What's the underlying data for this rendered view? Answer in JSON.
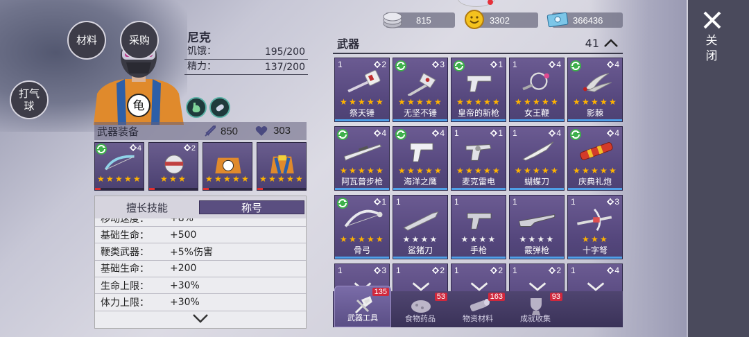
{
  "left_buttons": {
    "materials": "材料",
    "purchase": "采购",
    "orb": "打气球"
  },
  "character": {
    "name": "尼克",
    "hunger_label": "饥饿：",
    "hunger_value": "195/200",
    "energy_label": "精力：",
    "energy_value": "137/200",
    "chest_emblem": "龟"
  },
  "equipment": {
    "title": "武器装备",
    "attack": "850",
    "health": "303",
    "slots": [
      {
        "count": "4",
        "stars": 5,
        "recycle": true
      },
      {
        "count": "2",
        "stars": 3,
        "recycle": false
      },
      {
        "count": "",
        "stars": 5,
        "recycle": false
      },
      {
        "count": "",
        "stars": 5,
        "recycle": false
      }
    ]
  },
  "skills_panel": {
    "tab_skills": "擅长技能",
    "tab_titles": "称号",
    "rows": [
      {
        "label": "移动速度：",
        "value": "+8%"
      },
      {
        "label": "基础生命：",
        "value": "+500"
      },
      {
        "label": "鞭类武器：",
        "value": "+5%伤害"
      },
      {
        "label": "基础生命：",
        "value": "+200"
      },
      {
        "label": "生命上限：",
        "value": "+30%"
      },
      {
        "label": "体力上限：",
        "value": "+30%"
      }
    ]
  },
  "currency": {
    "silver": "815",
    "gold": "3302",
    "cash": "366436"
  },
  "inventory": {
    "category": "武器",
    "count": "41",
    "items": [
      {
        "name": "祭天锤",
        "lv": "1",
        "count": "2",
        "stars": 5,
        "recycle": false,
        "icon": "hammer"
      },
      {
        "name": "无坚不锤",
        "lv": "",
        "count": "3",
        "stars": 5,
        "recycle": true,
        "icon": "warhammer"
      },
      {
        "name": "皇帝的新枪",
        "lv": "",
        "count": "1",
        "stars": 5,
        "recycle": true,
        "icon": "pistol"
      },
      {
        "name": "女王鞭",
        "lv": "1",
        "count": "4",
        "stars": 5,
        "recycle": false,
        "icon": "whip"
      },
      {
        "name": "影棘",
        "lv": "",
        "count": "4",
        "stars": 5,
        "recycle": true,
        "icon": "claws"
      },
      {
        "name": "阿瓦普步枪",
        "lv": "",
        "count": "4",
        "stars": 5,
        "recycle": true,
        "icon": "rifle"
      },
      {
        "name": "海洋之鹰",
        "lv": "",
        "count": "4",
        "stars": 5,
        "recycle": true,
        "icon": "deagle"
      },
      {
        "name": "麦克雷电",
        "lv": "1",
        "count": "1",
        "stars": 5,
        "recycle": false,
        "icon": "revolver"
      },
      {
        "name": "蝴蝶刀",
        "lv": "1",
        "count": "4",
        "stars": 5,
        "recycle": false,
        "icon": "knife"
      },
      {
        "name": "庆典礼炮",
        "lv": "",
        "count": "4",
        "stars": 5,
        "recycle": true,
        "icon": "cannon"
      },
      {
        "name": "骨弓",
        "lv": "",
        "count": "1",
        "stars": 5,
        "recycle": true,
        "icon": "bow"
      },
      {
        "name": "鲨猪刀",
        "lv": "1",
        "count": "",
        "stars": 4,
        "stars_white": true,
        "recycle": false,
        "icon": "drill"
      },
      {
        "name": "手枪",
        "lv": "1",
        "count": "",
        "stars": 4,
        "stars_white": true,
        "recycle": false,
        "icon": "handgun"
      },
      {
        "name": "霰弹枪",
        "lv": "1",
        "count": "",
        "stars": 4,
        "stars_white": true,
        "recycle": false,
        "icon": "shotgun"
      },
      {
        "name": "十字弩",
        "lv": "1",
        "count": "3",
        "stars": 3,
        "recycle": false,
        "icon": "crossbow"
      },
      {
        "name": "",
        "lv": "1",
        "count": "3",
        "stars": 0,
        "recycle": false,
        "icon": "blank"
      },
      {
        "name": "",
        "lv": "1",
        "count": "2",
        "stars": 0,
        "recycle": false,
        "icon": "blank"
      },
      {
        "name": "",
        "lv": "1",
        "count": "2",
        "stars": 0,
        "recycle": false,
        "icon": "blank"
      },
      {
        "name": "",
        "lv": "1",
        "count": "2",
        "stars": 0,
        "recycle": false,
        "icon": "blank"
      },
      {
        "name": "",
        "lv": "1",
        "count": "4",
        "stars": 0,
        "recycle": false,
        "icon": "blank"
      }
    ]
  },
  "bottom_tabs": [
    {
      "label": "武器工具",
      "badge": "135",
      "active": true
    },
    {
      "label": "食物药品",
      "badge": "53",
      "active": false
    },
    {
      "label": "物资材料",
      "badge": "163",
      "active": false
    },
    {
      "label": "成就收集",
      "badge": "93",
      "active": false
    }
  ],
  "close_label": "关闭",
  "colors": {
    "card": "#5d4e85",
    "star": "#ffb300",
    "badge": "#d0283d",
    "sidebar": "#4a4a5c"
  }
}
